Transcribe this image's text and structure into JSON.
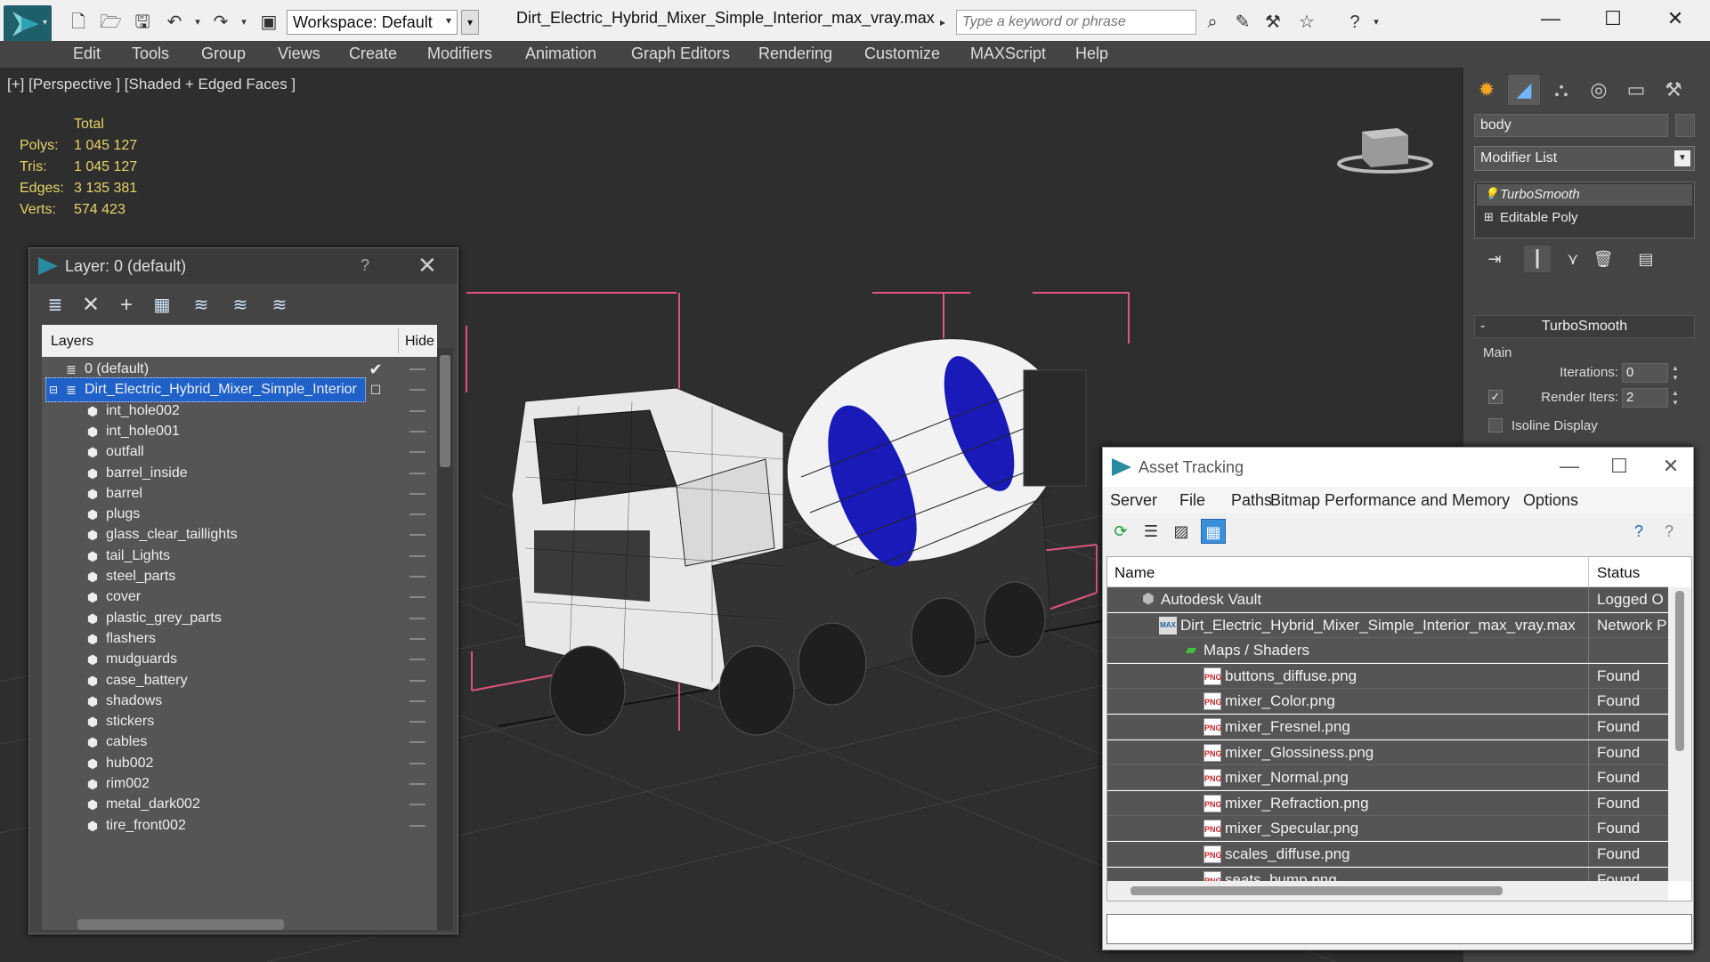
{
  "titlebar": {
    "workspace_label": "Workspace: Default",
    "document_title": "Dirt_Electric_Hybrid_Mixer_Simple_Interior_max_vray.max",
    "search_placeholder": "Type a keyword or phrase",
    "minimize": "—",
    "maximize": "☐",
    "close": "✕"
  },
  "menubar": [
    "Edit",
    "Tools",
    "Group",
    "Views",
    "Create",
    "Modifiers",
    "Animation",
    "Graph Editors",
    "Rendering",
    "Customize",
    "MAXScript",
    "Help"
  ],
  "viewport": {
    "label": "[+] [Perspective ] [Shaded + Edged Faces ]",
    "stats_header": "Total",
    "stats": [
      {
        "key": "Polys:",
        "value": "1 045 127"
      },
      {
        "key": "Tris:",
        "value": "1 045 127"
      },
      {
        "key": "Edges:",
        "value": "3 135 381"
      },
      {
        "key": "Verts:",
        "value": "574 423"
      }
    ]
  },
  "command_panel": {
    "object_name": "body",
    "modifier_list": "Modifier List",
    "stack": [
      "TurboSmooth",
      "Editable Poly"
    ],
    "rollout_title": "TurboSmooth",
    "main_group": "Main",
    "iterations_label": "Iterations:",
    "iterations_value": "0",
    "render_iters_label": "Render Iters:",
    "render_iters_value": "2",
    "isoline_label": "Isoline Display"
  },
  "layer_dialog": {
    "title": "Layer: 0 (default)",
    "help": "?",
    "close": "✕",
    "col_layers": "Layers",
    "col_hide": "Hide",
    "rows": [
      {
        "label": "0 (default)"
      },
      {
        "label": "Dirt_Electric_Hybrid_Mixer_Simple_Interior"
      },
      {
        "label": "int_hole002"
      },
      {
        "label": "int_hole001"
      },
      {
        "label": "outfall"
      },
      {
        "label": "barrel_inside"
      },
      {
        "label": "barrel"
      },
      {
        "label": "plugs"
      },
      {
        "label": "glass_clear_taillights"
      },
      {
        "label": "tail_Lights"
      },
      {
        "label": "steel_parts"
      },
      {
        "label": "cover"
      },
      {
        "label": "plastic_grey_parts"
      },
      {
        "label": "flashers"
      },
      {
        "label": "mudguards"
      },
      {
        "label": "case_battery"
      },
      {
        "label": "shadows"
      },
      {
        "label": "stickers"
      },
      {
        "label": "cables"
      },
      {
        "label": "hub002"
      },
      {
        "label": "rim002"
      },
      {
        "label": "metal_dark002"
      },
      {
        "label": "tire_front002"
      }
    ]
  },
  "asset_dialog": {
    "title": "Asset Tracking",
    "minimize": "—",
    "maximize": "☐",
    "close": "✕",
    "menu": [
      "Server",
      "File",
      "Paths",
      "Bitmap Performance and Memory",
      "Options"
    ],
    "col_name": "Name",
    "col_status": "Status",
    "rows": [
      {
        "name": "Autodesk Vault",
        "status": "Logged O"
      },
      {
        "name": "Dirt_Electric_Hybrid_Mixer_Simple_Interior_max_vray.max",
        "status": "Network P"
      },
      {
        "name": "Maps / Shaders",
        "status": ""
      },
      {
        "name": "buttons_diffuse.png",
        "status": "Found"
      },
      {
        "name": "mixer_Color.png",
        "status": "Found"
      },
      {
        "name": "mixer_Fresnel.png",
        "status": "Found"
      },
      {
        "name": "mixer_Glossiness.png",
        "status": "Found"
      },
      {
        "name": "mixer_Normal.png",
        "status": "Found"
      },
      {
        "name": "mixer_Refraction.png",
        "status": "Found"
      },
      {
        "name": "mixer_Specular.png",
        "status": "Found"
      },
      {
        "name": "scales_diffuse.png",
        "status": "Found"
      },
      {
        "name": "seats_bump.png",
        "status": "Found"
      }
    ],
    "png_badge": "PNG"
  },
  "colors": {
    "accent": "#1f61c9",
    "stats_text": "#e7d468",
    "selection_bracket": "#e0557a",
    "barrel_blue": "#1a1ab8"
  }
}
